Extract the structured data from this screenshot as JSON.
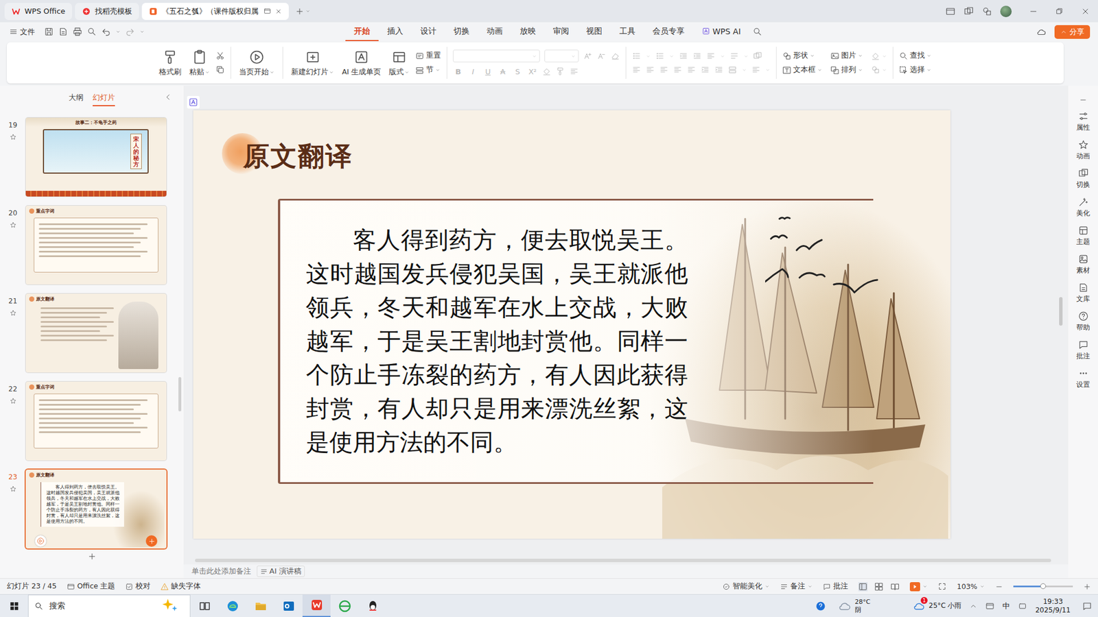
{
  "window": {
    "tabs": [
      {
        "label": "WPS Office",
        "selected": false
      },
      {
        "label": "找稻壳模板",
        "selected": false
      },
      {
        "label": "《五石之瓠》（课件版权归属",
        "selected": true
      }
    ]
  },
  "menu": {
    "file": "文件",
    "tabs": [
      {
        "label": "开始",
        "selected": true
      },
      {
        "label": "插入",
        "selected": false
      },
      {
        "label": "设计",
        "selected": false
      },
      {
        "label": "切换",
        "selected": false
      },
      {
        "label": "动画",
        "selected": false
      },
      {
        "label": "放映",
        "selected": false
      },
      {
        "label": "审阅",
        "selected": false
      },
      {
        "label": "视图",
        "selected": false
      },
      {
        "label": "工具",
        "selected": false
      },
      {
        "label": "会员专享",
        "selected": false
      },
      {
        "label": "WPS AI",
        "selected": false
      }
    ],
    "share": "分享"
  },
  "ribbon": {
    "clipboard": [
      "格式刷",
      "粘贴"
    ],
    "start": "当页开始",
    "slides": [
      "新建幻灯片",
      "AI 生成单页",
      "版式"
    ],
    "slide_small": [
      "重置",
      "节"
    ],
    "font_glyphs": [
      "B",
      "I",
      "U",
      "A",
      "S",
      "X²"
    ],
    "font_disabled": true,
    "insert": [
      "形状",
      "图片",
      "文本框",
      "排列"
    ],
    "edit": [
      "查找",
      "选择"
    ]
  },
  "panel": {
    "tabs": [
      {
        "label": "大纲",
        "selected": false
      },
      {
        "label": "幻灯片",
        "selected": true
      }
    ],
    "slides": [
      {
        "number": "19",
        "kind": "story",
        "title": "故事二：不龟手之药",
        "caption": "宋人的秘方",
        "selected": false
      },
      {
        "number": "20",
        "kind": "keywords",
        "title": "重点字词",
        "selected": false
      },
      {
        "number": "21",
        "kind": "translation-figure",
        "title": "原文翻译",
        "selected": false
      },
      {
        "number": "22",
        "kind": "keywords",
        "title": "重点字词",
        "selected": false
      },
      {
        "number": "23",
        "kind": "translation-text",
        "title": "原文翻译",
        "selected": true
      }
    ]
  },
  "slide": {
    "title": "原文翻译",
    "body": "客人得到药方，便去取悦吴王。这时越国发兵侵犯吴国，吴王就派他领兵，冬天和越军在水上交战，大败越军，于是吴王割地封赏他。同样一个防止手冻裂的药方，有人因此获得封赏，有人却只是用来漂洗丝絮，这是使用方法的不同。"
  },
  "notes": {
    "placeholder": "单击此处添加备注",
    "ai": "AI 演讲稿"
  },
  "right_bar": [
    "属性",
    "动画",
    "切换",
    "美化",
    "主题",
    "素材",
    "文库",
    "帮助",
    "批注",
    "设置"
  ],
  "status_bar": {
    "slide": "幻灯片 23 / 45",
    "theme": "Office 主题",
    "proofing": "校对",
    "missing_font": "缺失字体",
    "beautify": "智能美化",
    "notes": "备注",
    "comments": "批注",
    "zoom": "103%",
    "zoom_level": 0.5
  },
  "taskbar": {
    "search": "搜索",
    "weather_temp": "28°C",
    "weather_cond": "阴",
    "weather2": "25°C 小雨",
    "weather_badge": "1",
    "ime": "中",
    "time": "19:33",
    "date": "2025/9/11"
  }
}
